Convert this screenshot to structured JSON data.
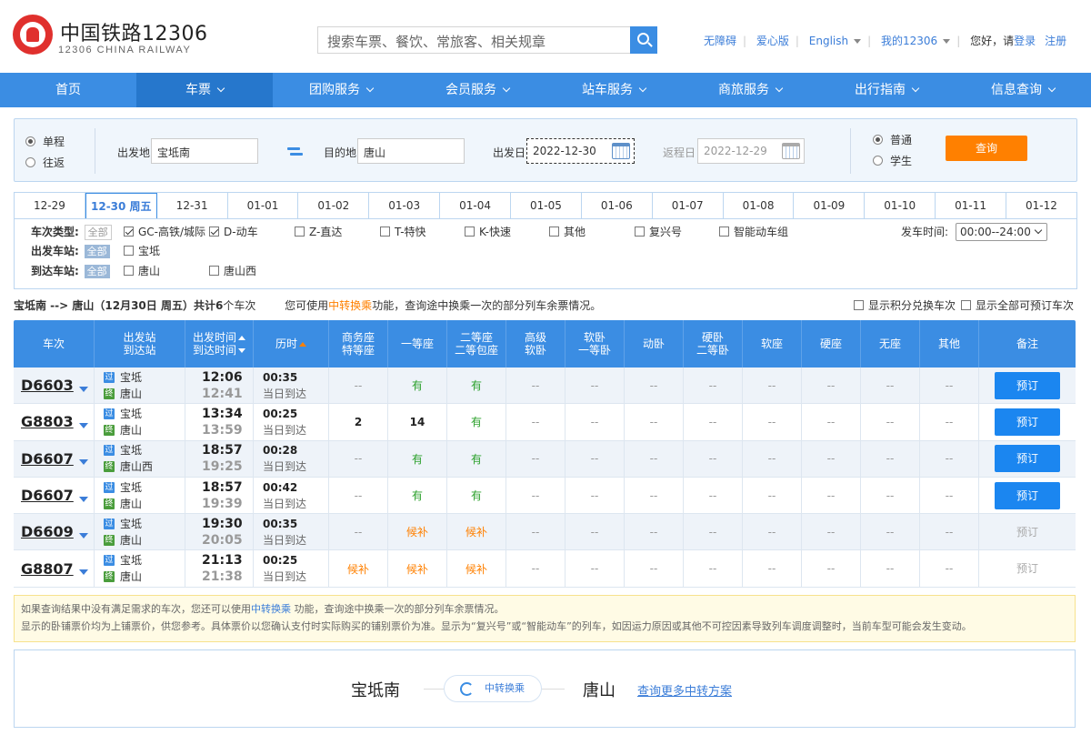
{
  "header": {
    "brand": "中国铁路12306",
    "brand_sub": "12306 CHINA RAILWAY",
    "search_placeholder": "搜索车票、餐饮、常旅客、相关规章",
    "links": {
      "accessible": "无障碍",
      "care": "爱心版",
      "english": "English",
      "my12306": "我的12306",
      "greeting": "您好，请",
      "login": "登录",
      "register": "注册"
    }
  },
  "nav": [
    "首页",
    "车票",
    "团购服务",
    "会员服务",
    "站车服务",
    "商旅服务",
    "出行指南",
    "信息查询"
  ],
  "query": {
    "oneway": "单程",
    "roundtrip": "往返",
    "from_label": "出发地",
    "from_value": "宝坻南",
    "to_label": "目的地",
    "to_value": "唐山",
    "date_label": "出发日",
    "date_value": "2022-12-30",
    "return_label": "返程日",
    "return_value": "2022-12-29",
    "normal": "普通",
    "student": "学生",
    "search_btn": "查询"
  },
  "dates": [
    "12-29",
    "12-30 周五",
    "12-31",
    "01-01",
    "01-02",
    "01-03",
    "01-04",
    "01-05",
    "01-06",
    "01-07",
    "01-08",
    "01-09",
    "01-10",
    "01-11",
    "01-12"
  ],
  "filters": {
    "type_label": "车次类型:",
    "all": "全部",
    "types": [
      "GC-高铁/城际",
      "D-动车",
      "Z-直达",
      "T-特快",
      "K-快速",
      "其他",
      "复兴号",
      "智能动车组"
    ],
    "dep_label": "出发车站:",
    "dep_stations": [
      "宝坻"
    ],
    "arr_label": "到达车站:",
    "arr_stations": [
      "唐山",
      "唐山西"
    ],
    "time_label": "发车时间:",
    "time_value": "00:00--24:00"
  },
  "summary": {
    "route": "宝坻南 --> 唐山（12月30日  周五）共计",
    "count": "6",
    "unit": "个车次",
    "hint_pre": "您可使用",
    "hint_link": "中转换乘",
    "hint_post": "功能，查询途中换乘一次的部分列车余票情况。",
    "opt1": "显示积分兑换车次",
    "opt2": "显示全部可预订车次"
  },
  "table": {
    "headers": {
      "train": "车次",
      "stations_1": "出发站",
      "stations_2": "到达站",
      "time_1": "出发时间",
      "time_2": "到达时间",
      "duration": "历时",
      "business_1": "商务座",
      "business_2": "特等座",
      "first": "一等座",
      "second_1": "二等座",
      "second_2": "二等包座",
      "adv_1": "高级",
      "adv_2": "软卧",
      "soft_1": "软卧",
      "soft_2": "一等卧",
      "dongwo": "动卧",
      "hard_1": "硬卧",
      "hard_2": "二等卧",
      "softseat": "软座",
      "hardseat": "硬座",
      "noseat": "无座",
      "other": "其他",
      "remark": "备注"
    },
    "start_icon": "过",
    "end_icon": "终",
    "rows": [
      {
        "no": "D6603",
        "from": "宝坻",
        "to": "唐山",
        "dep": "12:06",
        "arr": "12:41",
        "dur": "00:35",
        "day": "当日到达",
        "seats": [
          "--",
          "有",
          "有",
          "--",
          "--",
          "--",
          "--",
          "--",
          "--",
          "--",
          "--"
        ],
        "book": "预订"
      },
      {
        "no": "G8803",
        "from": "宝坻",
        "to": "唐山",
        "dep": "13:34",
        "arr": "13:59",
        "dur": "00:25",
        "day": "当日到达",
        "seats": [
          "2",
          "14",
          "有",
          "--",
          "--",
          "--",
          "--",
          "--",
          "--",
          "--",
          "--"
        ],
        "book": "预订"
      },
      {
        "no": "D6607",
        "from": "宝坻",
        "to": "唐山西",
        "dep": "18:57",
        "arr": "19:25",
        "dur": "00:28",
        "day": "当日到达",
        "seats": [
          "--",
          "有",
          "有",
          "--",
          "--",
          "--",
          "--",
          "--",
          "--",
          "--",
          "--"
        ],
        "book": "预订"
      },
      {
        "no": "D6607",
        "from": "宝坻",
        "to": "唐山",
        "dep": "18:57",
        "arr": "19:39",
        "dur": "00:42",
        "day": "当日到达",
        "seats": [
          "--",
          "有",
          "有",
          "--",
          "--",
          "--",
          "--",
          "--",
          "--",
          "--",
          "--"
        ],
        "book": "预订"
      },
      {
        "no": "D6609",
        "from": "宝坻",
        "to": "唐山",
        "dep": "19:30",
        "arr": "20:05",
        "dur": "00:35",
        "day": "当日到达",
        "seats": [
          "--",
          "候补",
          "候补",
          "--",
          "--",
          "--",
          "--",
          "--",
          "--",
          "--",
          "--"
        ],
        "book": "预订"
      },
      {
        "no": "G8807",
        "from": "宝坻",
        "to": "唐山",
        "dep": "21:13",
        "arr": "21:38",
        "dur": "00:25",
        "day": "当日到达",
        "seats": [
          "候补",
          "候补",
          "候补",
          "--",
          "--",
          "--",
          "--",
          "--",
          "--",
          "--",
          "--"
        ],
        "book": "预订"
      }
    ]
  },
  "notice": {
    "line1_pre": "如果查询结果中没有满足需求的车次，您还可以使用",
    "line1_link": "中转换乘",
    "line1_post": " 功能，查询途中换乘一次的部分列车余票情况。",
    "line2": "显示的卧铺票价均为上铺票价，供您参考。具体票价以您确认支付时实际购买的铺别票价为准。显示为“复兴号”或“智能动车”的列车，如因运力原因或其他不可控因素导致列车调度调整时，当前车型可能会发生变动。"
  },
  "transfer": {
    "from": "宝坻南",
    "pill": "中转换乘",
    "to": "唐山",
    "more": "查询更多中转方案"
  }
}
